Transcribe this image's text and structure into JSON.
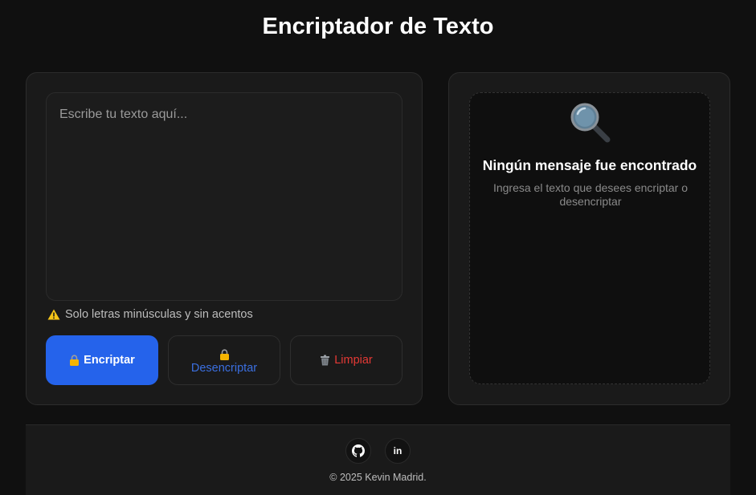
{
  "header": {
    "title": "Encriptador de Texto"
  },
  "input": {
    "placeholder": "Escribe tu texto aquí...",
    "value": ""
  },
  "warning": {
    "icon": "warning-icon",
    "text": "Solo letras minúsculas y sin acentos"
  },
  "actions": {
    "encrypt_label": "Encriptar",
    "decrypt_label": "Desencriptar",
    "clear_label": "Limpiar",
    "encrypt_icon": "lock-icon",
    "decrypt_icon": "lock-icon",
    "clear_icon": "trash-icon"
  },
  "output": {
    "icon": "search-icon",
    "heading": "Ningún mensaje fue encontrado",
    "subtext": "Ingresa el texto que desees encriptar o desencriptar"
  },
  "footer": {
    "social": [
      "github-icon",
      "linkedin-icon"
    ],
    "linkedin_text": "in",
    "copyright": "© 2025 Kevin Madrid."
  },
  "colors": {
    "background": "#101010",
    "card": "#1a1a1a",
    "accent": "#2563eb",
    "decrypt_text": "#3b6fe0",
    "clear_text": "#e53935",
    "warning": "#f5c518"
  }
}
